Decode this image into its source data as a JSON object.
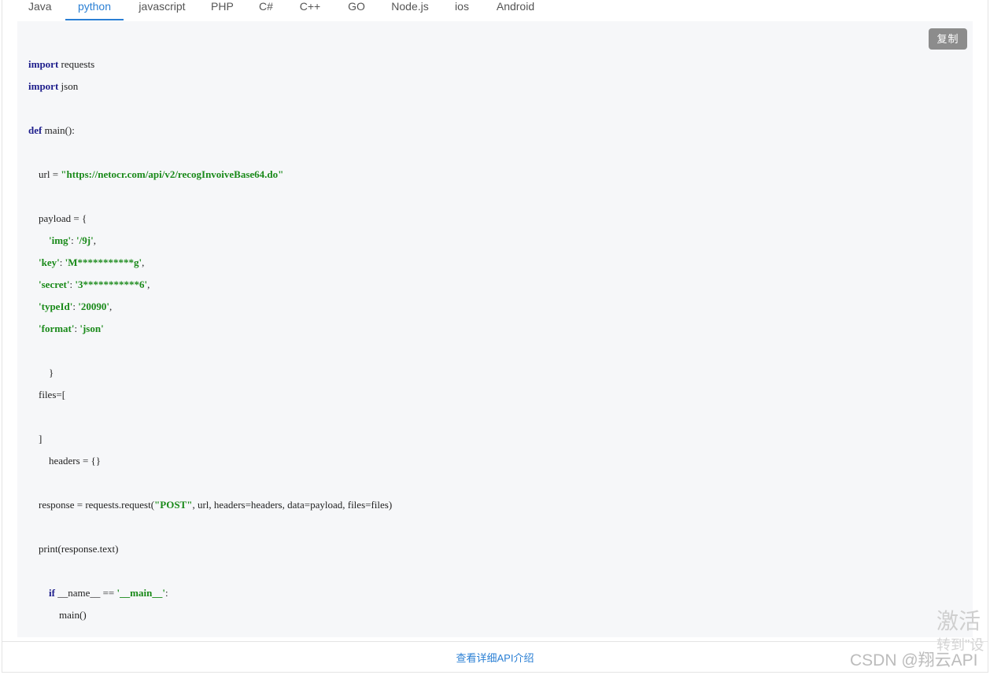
{
  "tabs": [
    {
      "label": "Java",
      "active": false
    },
    {
      "label": "python",
      "active": true
    },
    {
      "label": "javascript",
      "active": false
    },
    {
      "label": "PHP",
      "active": false
    },
    {
      "label": "C#",
      "active": false
    },
    {
      "label": "C++",
      "active": false
    },
    {
      "label": "GO",
      "active": false
    },
    {
      "label": "Node.js",
      "active": false
    },
    {
      "label": "ios",
      "active": false
    },
    {
      "label": "Android",
      "active": false
    }
  ],
  "copy_button": {
    "label": "复制"
  },
  "code": {
    "lines": [
      {
        "indent": "",
        "parts": [
          [
            "kw",
            "import"
          ],
          [
            "",
            " requests"
          ]
        ]
      },
      {
        "indent": "",
        "parts": [
          [
            "kw",
            "import"
          ],
          [
            "",
            " json"
          ]
        ]
      },
      {
        "indent": "",
        "parts": [
          [
            "kw",
            "def"
          ],
          [
            "",
            " main():"
          ]
        ]
      },
      {
        "indent": "    ",
        "parts": [
          [
            "",
            "url = "
          ],
          [
            "str",
            "\"https://netocr.com/api/v2/recogInvoiveBase64.do\""
          ]
        ]
      },
      {
        "indent": "    ",
        "parts": [
          [
            "",
            "payload = {"
          ]
        ]
      },
      {
        "indent": "        ",
        "parts": [
          [
            "str",
            "'img'"
          ],
          [
            "",
            ": "
          ],
          [
            "str",
            "'/9j'"
          ],
          [
            "",
            ","
          ]
        ]
      },
      {
        "indent": "    ",
        "parts": [
          [
            "str",
            "'key'"
          ],
          [
            "",
            ": "
          ],
          [
            "str",
            "'M***********g'"
          ],
          [
            "",
            ","
          ]
        ]
      },
      {
        "indent": "    ",
        "parts": [
          [
            "str",
            "'secret'"
          ],
          [
            "",
            ": "
          ],
          [
            "str",
            "'3***********6'"
          ],
          [
            "",
            ","
          ]
        ]
      },
      {
        "indent": "    ",
        "parts": [
          [
            "str",
            "'typeId'"
          ],
          [
            "",
            ": "
          ],
          [
            "str",
            "'20090'"
          ],
          [
            "",
            ","
          ]
        ]
      },
      {
        "indent": "    ",
        "parts": [
          [
            "str",
            "'format'"
          ],
          [
            "",
            ": "
          ],
          [
            "str",
            "'json'"
          ]
        ]
      },
      {
        "indent": "        ",
        "parts": [
          [
            "",
            "}"
          ]
        ]
      },
      {
        "indent": "    ",
        "parts": [
          [
            "",
            "files=["
          ]
        ]
      },
      {
        "indent": "    ",
        "parts": [
          [
            "",
            "]"
          ]
        ]
      },
      {
        "indent": "        ",
        "parts": [
          [
            "",
            "headers = {}"
          ]
        ]
      },
      {
        "indent": "    ",
        "parts": [
          [
            "",
            "response = requests.request("
          ],
          [
            "str",
            "\"POST\""
          ],
          [
            "",
            ", url, headers=headers, data=payload, files=files)"
          ]
        ]
      },
      {
        "indent": "    ",
        "parts": [
          [
            "",
            "print(response.text)"
          ]
        ]
      },
      {
        "indent": "        ",
        "parts": [
          [
            "kw",
            "if"
          ],
          [
            "",
            " __name__ == "
          ],
          [
            "str",
            "'__main__'"
          ],
          [
            "",
            ":"
          ]
        ]
      },
      {
        "indent": "            ",
        "parts": [
          [
            "",
            "main()"
          ]
        ]
      }
    ]
  },
  "footer": {
    "link_label": "查看详细API介绍"
  },
  "watermarks": {
    "activate": "激活",
    "goto": "转到\"设",
    "csdn": "CSDN @翔云API"
  }
}
